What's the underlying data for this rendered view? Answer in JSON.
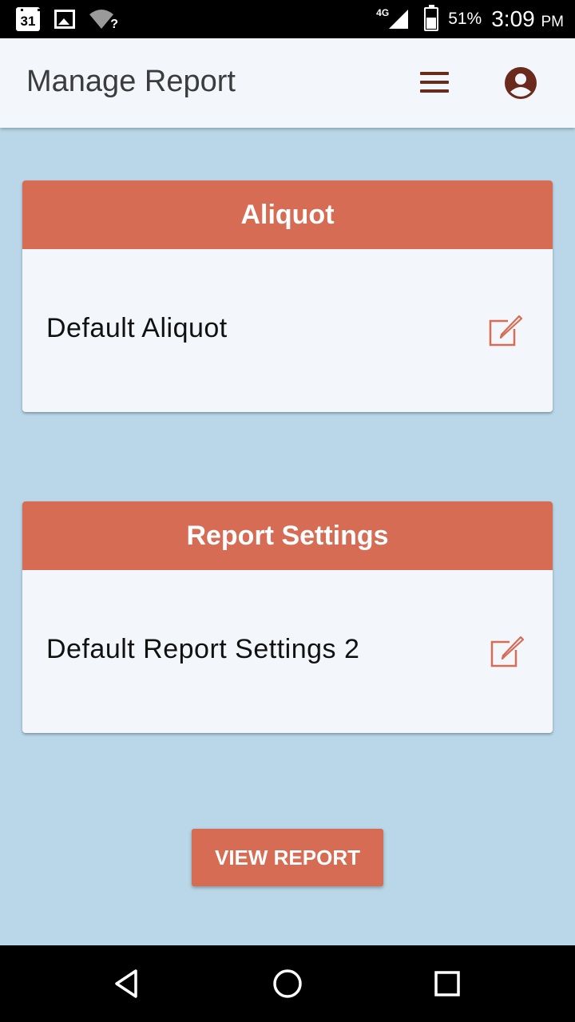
{
  "status_bar": {
    "calendar_day": "31",
    "wifi_question": "?",
    "network": "4G",
    "battery": "51%",
    "time": "3:09",
    "ampm": "PM",
    "icons": [
      "calendar-icon",
      "gallery-icon",
      "wifi-icon",
      "signal-icon",
      "battery-icon"
    ]
  },
  "app_bar": {
    "title": "Manage Report",
    "icons": [
      "menu-icon",
      "account-circle-icon"
    ],
    "icon_color": "#6b2b1c"
  },
  "cards": [
    {
      "header": "Aliquot",
      "item_label": "Default Aliquot",
      "icon": "edit-icon"
    },
    {
      "header": "Report Settings",
      "item_label": "Default Report Settings 2",
      "icon": "edit-icon"
    }
  ],
  "view_report_button": "VIEW REPORT",
  "nav_bar": {
    "icons": [
      "back-icon",
      "home-icon",
      "recent-apps-icon"
    ]
  },
  "colors": {
    "accent": "#d56c53",
    "background": "#b9d7e8",
    "surface": "#f3f7fc",
    "title_text": "#3c3c3c"
  }
}
